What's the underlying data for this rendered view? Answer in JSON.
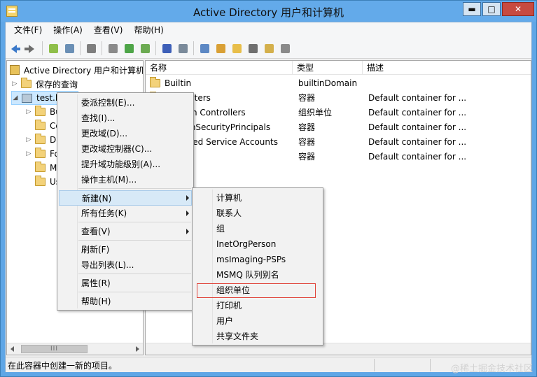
{
  "window": {
    "title": "Active Directory 用户和计算机",
    "min_label": "▬",
    "max_label": "□",
    "close_label": "✕"
  },
  "menubar": [
    "文件(F)",
    "操作(A)",
    "查看(V)",
    "帮助(H)"
  ],
  "toolbar": [
    {
      "name": "back-icon",
      "color": "#3a78c9"
    },
    {
      "name": "forward-icon",
      "color": "#6d6d6d"
    },
    {
      "name": "up-folder-icon",
      "color": "#8fbf4a"
    },
    {
      "name": "show-tree-icon",
      "color": "#6a8fb5"
    },
    {
      "name": "clipboard-icon",
      "color": "#7e7e7e"
    },
    {
      "name": "copy-icon",
      "color": "#8a8a8a"
    },
    {
      "name": "refresh-icon",
      "color": "#4ea548"
    },
    {
      "name": "export-list-icon",
      "color": "#6cab52"
    },
    {
      "name": "help-icon",
      "color": "#3d5fb8"
    },
    {
      "name": "properties-icon",
      "color": "#7a8a9a"
    },
    {
      "name": "new-user-icon",
      "color": "#5c88c4"
    },
    {
      "name": "new-group-icon",
      "color": "#d9a035"
    },
    {
      "name": "new-ou-icon",
      "color": "#e8be4a"
    },
    {
      "name": "filter-icon",
      "color": "#6f6f6f"
    },
    {
      "name": "find-icon",
      "color": "#d4b04c"
    },
    {
      "name": "add-to-group-icon",
      "color": "#8a8a8a"
    }
  ],
  "tree": {
    "root_label": "Active Directory 用户和计算机",
    "items": [
      {
        "label": "保存的查询",
        "indent": 1,
        "expander": "▷",
        "icon": "folder"
      },
      {
        "label": "test.local",
        "indent": 1,
        "expander": "◢",
        "icon": "domain",
        "selected": true
      },
      {
        "label": "Builtin",
        "indent": 2,
        "expander": "▷",
        "icon": "folder"
      },
      {
        "label": "Computers",
        "indent": 2,
        "expander": "",
        "icon": "folder"
      },
      {
        "label": "Domain Controllers",
        "indent": 2,
        "expander": "▷",
        "icon": "folder"
      },
      {
        "label": "ForeignSecurityPrincipals",
        "indent": 2,
        "expander": "▷",
        "icon": "folder"
      },
      {
        "label": "Managed Service Accounts",
        "indent": 2,
        "expander": "",
        "icon": "folder"
      },
      {
        "label": "Users",
        "indent": 2,
        "expander": "",
        "icon": "folder"
      }
    ]
  },
  "list": {
    "columns": [
      "名称",
      "类型",
      "描述"
    ],
    "rows": [
      {
        "name": "Builtin",
        "type": "builtinDomain",
        "desc": ""
      },
      {
        "name": "Computers",
        "type": "容器",
        "desc": "Default container for ..."
      },
      {
        "name": "Domain Controllers",
        "type": "组织单位",
        "desc": "Default container for ..."
      },
      {
        "name": "ForeignSecurityPrincipals",
        "type": "容器",
        "desc": "Default container for ..."
      },
      {
        "name": "Managed Service Accounts",
        "type": "容器",
        "desc": "Default container for ..."
      },
      {
        "name": "Users",
        "type": "容器",
        "desc": "Default container for ..."
      }
    ]
  },
  "context_menu": {
    "items": [
      "委派控制(E)...",
      "查找(I)...",
      "更改域(D)...",
      "更改域控制器(C)...",
      "提升域功能级别(A)...",
      "操作主机(M)...",
      "新建(N)",
      "所有任务(K)",
      "查看(V)",
      "刷新(F)",
      "导出列表(L)...",
      "属性(R)",
      "帮助(H)"
    ],
    "highlighted": "新建(N)"
  },
  "submenu": {
    "items": [
      "计算机",
      "联系人",
      "组",
      "InetOrgPerson",
      "msImaging-PSPs",
      "MSMQ 队列别名",
      "组织单位",
      "打印机",
      "用户",
      "共享文件夹"
    ],
    "boxed": "组织单位"
  },
  "statusbar": {
    "text": "在此容器中创建一新的项目。"
  },
  "watermark": "@稀土掘金技术社区"
}
